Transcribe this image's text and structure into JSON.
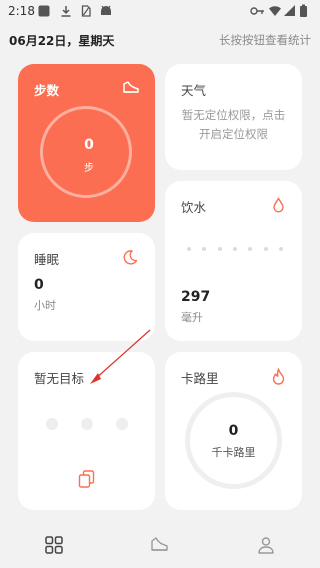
{
  "status_bar": {
    "time": "2:18",
    "icons_left": [
      "notification-square-icon",
      "download-icon",
      "sim-card-icon",
      "android-icon"
    ],
    "icons_right": [
      "key-icon",
      "wifi-icon",
      "signal-icon",
      "battery-icon"
    ]
  },
  "header": {
    "date": "06月22日，星期天",
    "hint": "长按按钮查看统计"
  },
  "steps": {
    "title": "步数",
    "value": "0",
    "unit": "步",
    "icon": "shoe-icon",
    "color": "#fb6e52"
  },
  "weather": {
    "title": "天气",
    "message": "暂无定位权限，点击开启定位权限"
  },
  "water": {
    "title": "饮水",
    "value": "297",
    "unit": "毫升",
    "icon": "water-drop-icon"
  },
  "sleep": {
    "title": "睡眠",
    "value": "0",
    "unit": "小时",
    "icon": "moon-icon"
  },
  "goal": {
    "title": "暂无目标",
    "icon": "copy-icon"
  },
  "calories": {
    "title": "卡路里",
    "value": "0",
    "unit": "千卡路里",
    "icon": "flame-icon"
  },
  "accent_color": "#fb6e52",
  "bottom_nav": {
    "items": [
      "grid-icon",
      "shoe-icon",
      "person-icon"
    ],
    "active": "grid-icon"
  }
}
